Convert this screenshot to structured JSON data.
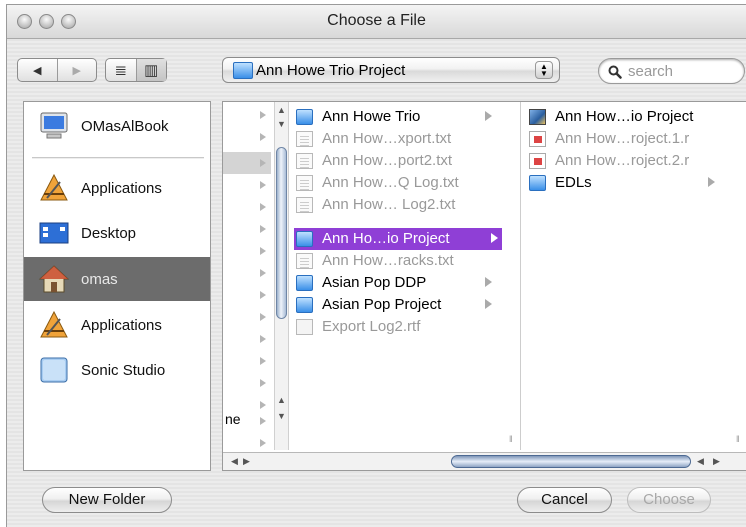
{
  "window": {
    "title": "Choose a File"
  },
  "toolbar": {
    "back_icon": "◀",
    "forward_icon": "▶",
    "list_view_icon": "≣",
    "column_view_icon": "▥",
    "location": "Ann Howe Trio Project",
    "search_placeholder": "search"
  },
  "sidebar": {
    "items": [
      {
        "label": "OMasAlBook",
        "icon": "computer-icon"
      },
      {
        "label": "Applications",
        "icon": "applications-icon"
      },
      {
        "label": "Desktop",
        "icon": "desktop-icon"
      },
      {
        "label": "omas",
        "icon": "home-icon",
        "selected": true
      },
      {
        "label": "Applications",
        "icon": "applications-icon"
      },
      {
        "label": "Sonic Studio",
        "icon": "drive-icon"
      }
    ]
  },
  "browser": {
    "col1_partial_text": "ne",
    "col2": [
      {
        "name": "Ann Howe Trio",
        "kind": "folder",
        "arrow": true
      },
      {
        "name": "Ann How…xport.txt",
        "kind": "document",
        "dim": true
      },
      {
        "name": "Ann How…port2.txt",
        "kind": "document",
        "dim": true
      },
      {
        "name": "Ann How…Q Log.txt",
        "kind": "document",
        "dim": true
      },
      {
        "name": "Ann How… Log2.txt",
        "kind": "document",
        "dim": true
      },
      {
        "name": "Ann Ho…io Project",
        "kind": "folder",
        "arrow": true,
        "selected": true
      },
      {
        "name": "Ann How…racks.txt",
        "kind": "document",
        "dim": true
      },
      {
        "name": "Asian Pop DDP",
        "kind": "folder",
        "arrow": true
      },
      {
        "name": "Asian Pop Project",
        "kind": "folder",
        "arrow": true
      },
      {
        "name": "Export Log2.rtf",
        "kind": "rtf",
        "dim": true
      }
    ],
    "col3": [
      {
        "name": "Ann How…io Project",
        "kind": "project"
      },
      {
        "name": "Ann How…roject.1.r",
        "kind": "session",
        "dim": true
      },
      {
        "name": "Ann How…roject.2.r",
        "kind": "session",
        "dim": true
      },
      {
        "name": "EDLs",
        "kind": "folder",
        "arrow": true
      }
    ]
  },
  "buttons": {
    "new_folder": "New Folder",
    "cancel": "Cancel",
    "choose": "Choose"
  }
}
